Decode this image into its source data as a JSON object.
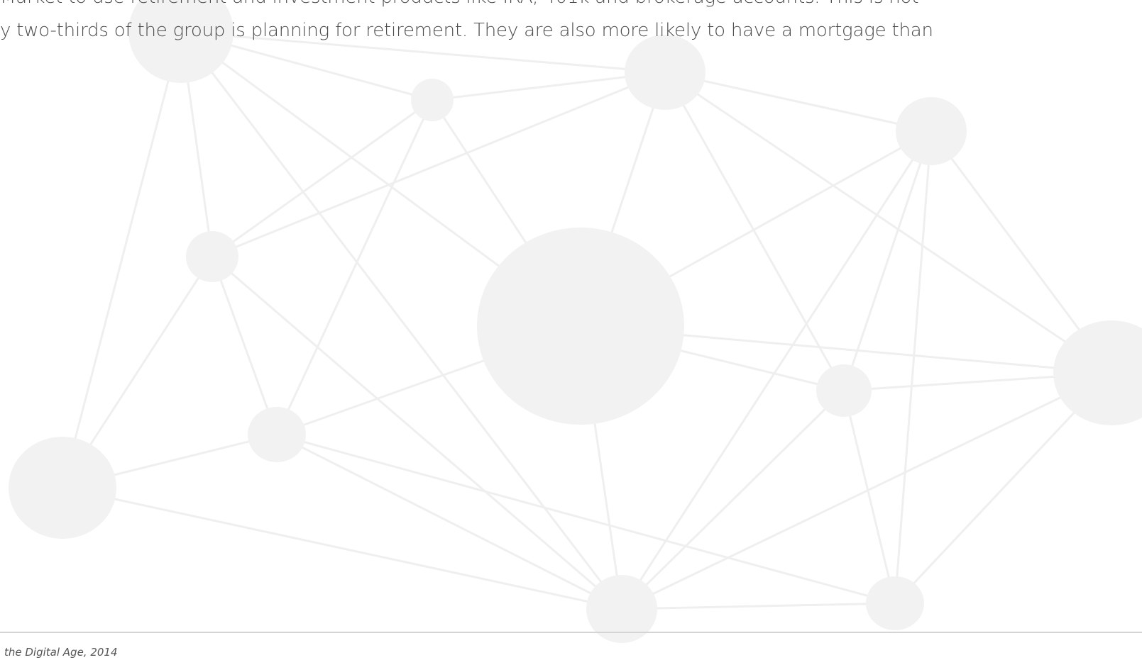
{
  "paragraph": {
    "lines": [
      "Market to use retirement and investment products like IRA, 401k and brokerage accounts. This is not",
      "y two-thirds of the group is planning for retirement. They are also more likely to have a mortgage than"
    ]
  },
  "footer": {
    "source": "the Digital Age, 2014"
  },
  "colors": {
    "node_fill": "#f2f2f2",
    "edge_stroke": "#efefef",
    "text": "#4b4b4b",
    "rule": "#d4d4d4"
  }
}
